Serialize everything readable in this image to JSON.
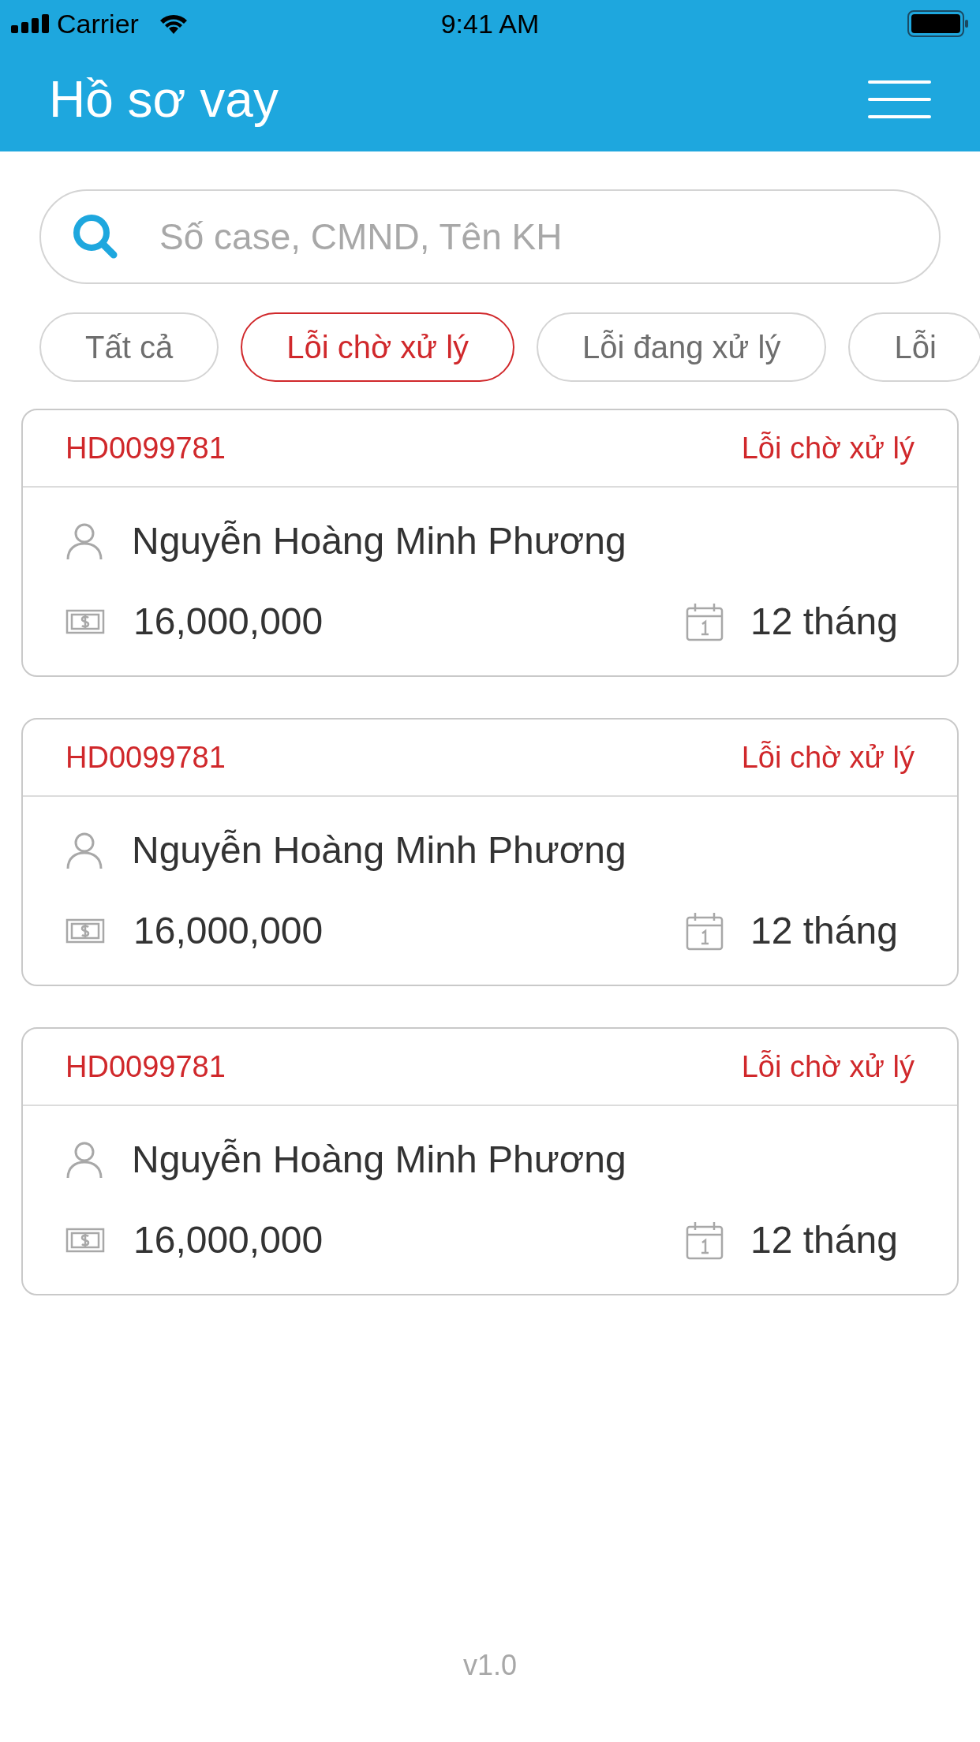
{
  "status_bar": {
    "carrier": "Carrier",
    "time": "9:41 AM"
  },
  "header": {
    "title": "Hồ sơ vay"
  },
  "search": {
    "placeholder": "Số case, CMND, Tên KH"
  },
  "filters": [
    {
      "label": "Tất cả",
      "selected": false
    },
    {
      "label": "Lỗi chờ xử lý",
      "selected": true
    },
    {
      "label": "Lỗi đang xử lý",
      "selected": false
    },
    {
      "label": "Lỗi",
      "selected": false
    }
  ],
  "cards": [
    {
      "code": "HD0099781",
      "status": "Lỗi chờ xử lý",
      "name": "Nguyễn Hoàng Minh Phương",
      "amount": "16,000,000",
      "term": "12 tháng"
    },
    {
      "code": "HD0099781",
      "status": "Lỗi chờ xử lý",
      "name": "Nguyễn Hoàng Minh Phương",
      "amount": "16,000,000",
      "term": "12 tháng"
    },
    {
      "code": "HD0099781",
      "status": "Lỗi chờ xử lý",
      "name": "Nguyễn Hoàng Minh Phương",
      "amount": "16,000,000",
      "term": "12 tháng"
    }
  ],
  "version": "v1.0"
}
